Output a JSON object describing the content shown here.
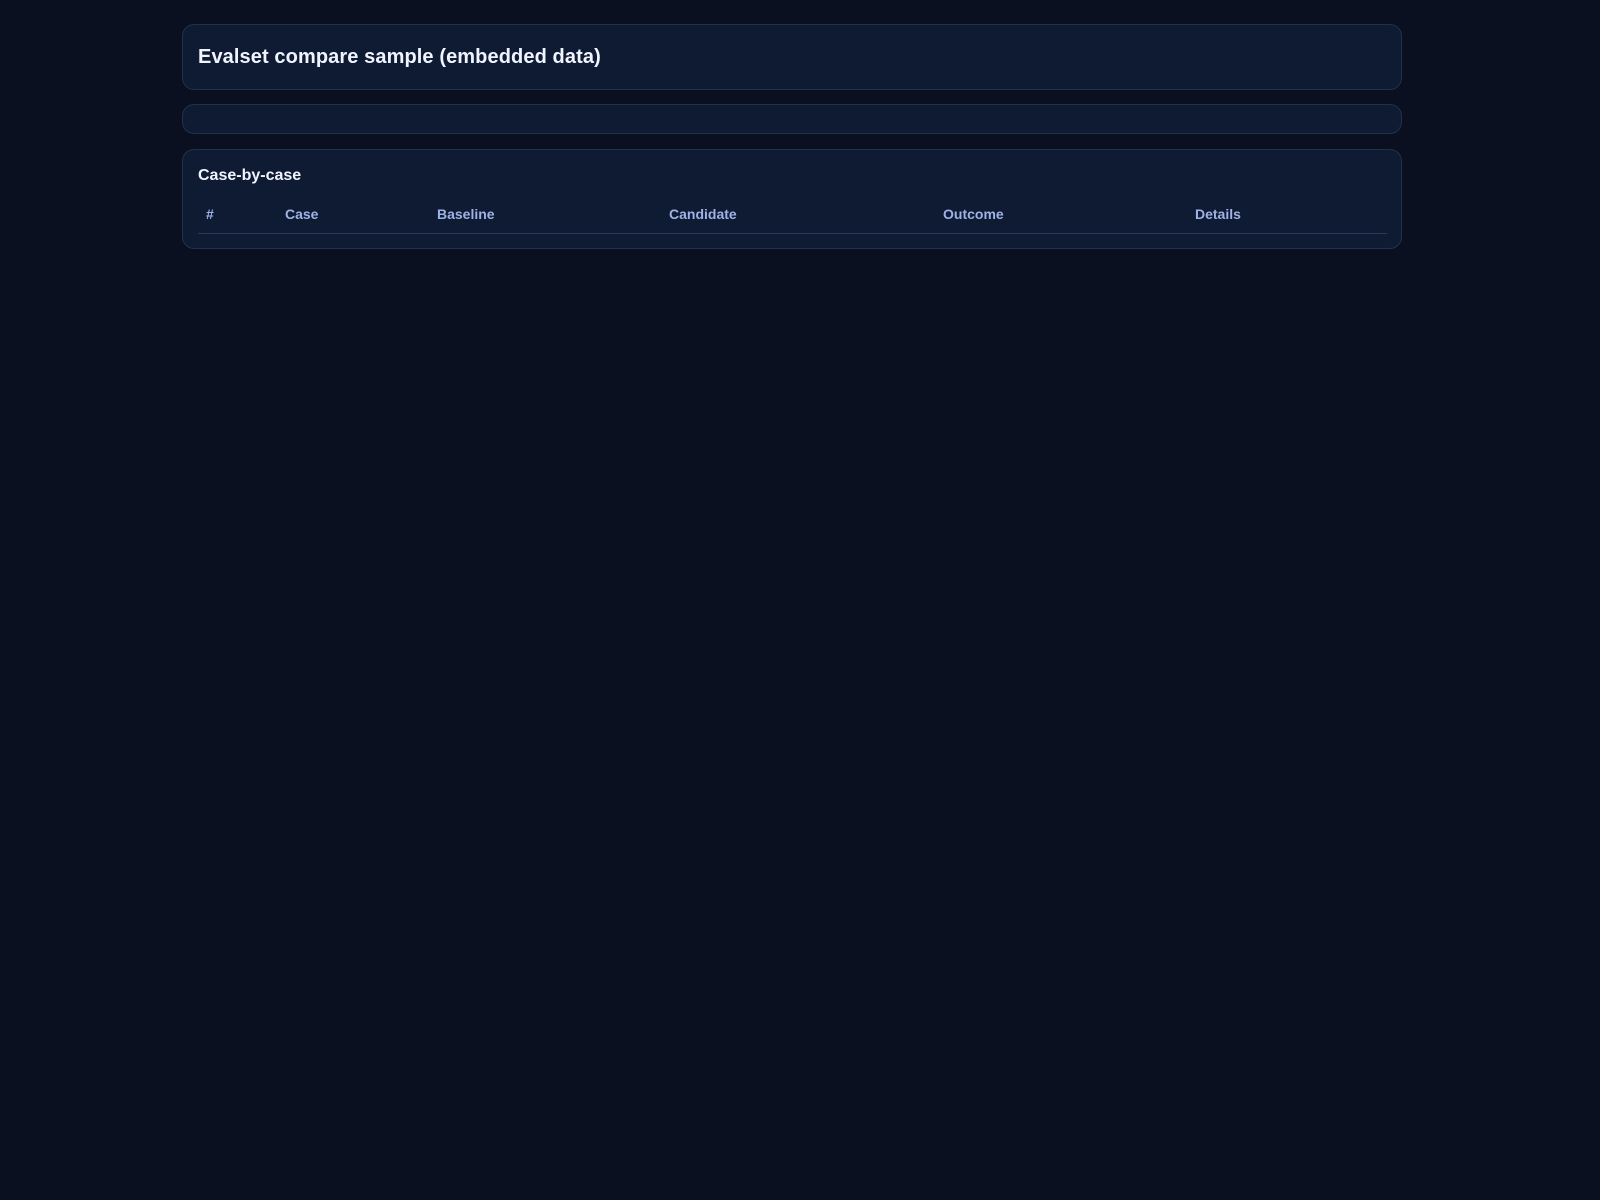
{
  "header": {
    "title": "Evalset compare sample (embedded data)"
  },
  "summary": {},
  "cases_section": {
    "title": "Case-by-case",
    "columns": [
      "#",
      "Case",
      "Baseline",
      "Candidate",
      "Outcome",
      "Details"
    ],
    "rows": []
  },
  "colors": {
    "background": "#0a1020",
    "card": "#0f1a33",
    "border": "#22304f",
    "header_text": "#9fb2e6"
  }
}
